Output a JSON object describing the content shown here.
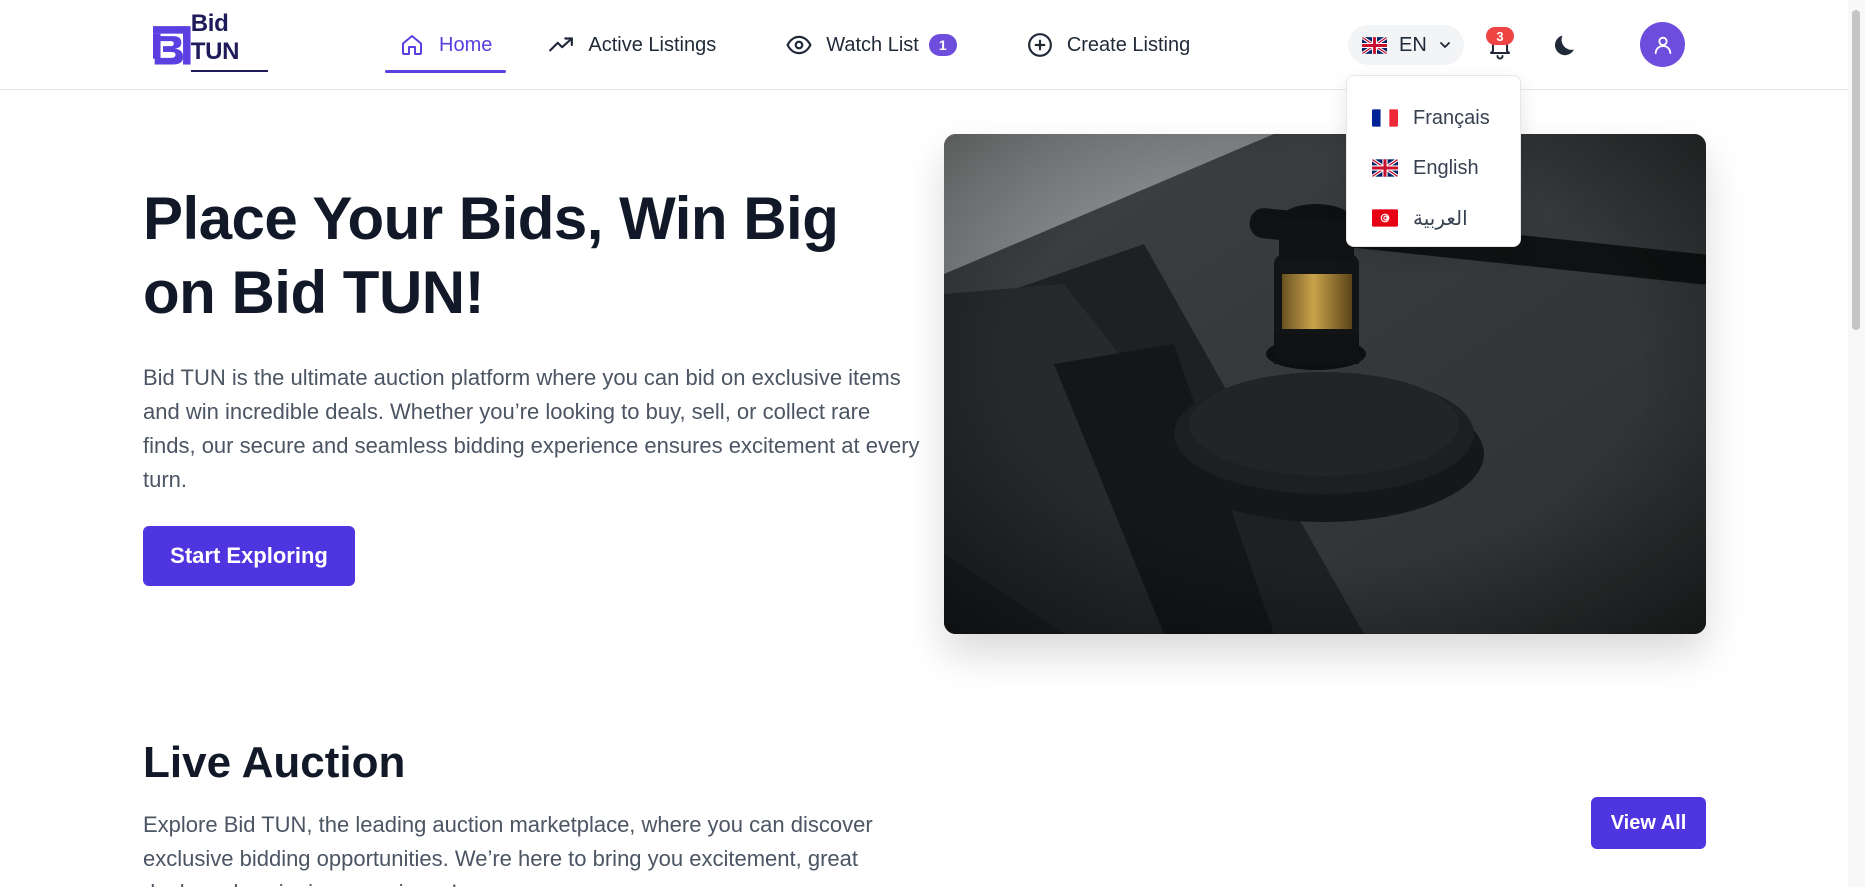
{
  "brand": {
    "name": "Bid TUN",
    "mark_letters": "BT"
  },
  "nav": {
    "home": "Home",
    "active_listings": "Active Listings",
    "watch_list": "Watch List",
    "watch_count": "1",
    "create_listing": "Create Listing"
  },
  "header": {
    "language_code": "EN",
    "notification_count": "3"
  },
  "language_menu": {
    "items": [
      {
        "label": "Français",
        "flag": "france-flag"
      },
      {
        "label": "English",
        "flag": "uk-flag"
      },
      {
        "label": "العربية",
        "flag": "tunisia-flag"
      }
    ]
  },
  "hero": {
    "title_line1": "Place Your Bids, Win Big",
    "title_line2": "on Bid TUN!",
    "description": "Bid TUN is the ultimate auction platform where you can bid on exclusive items and win incredible deals. Whether you’re looking to buy, sell, or collect rare finds, our secure and seamless bidding experience ensures excitement at every turn.",
    "cta": "Start Exploring",
    "image": "gavel-photo"
  },
  "live_auction": {
    "title": "Live Auction",
    "description": "Explore Bid TUN, the leading auction marketplace, where you can discover exclusive bidding opportunities. We’re here to bring you excitement, great deals and a winning experience!",
    "view_all": "View All"
  },
  "colors": {
    "accent": "#4f35e0",
    "nav_active": "#5b3fe0",
    "badge": "#6d4ddb",
    "notification": "#ef4444"
  }
}
